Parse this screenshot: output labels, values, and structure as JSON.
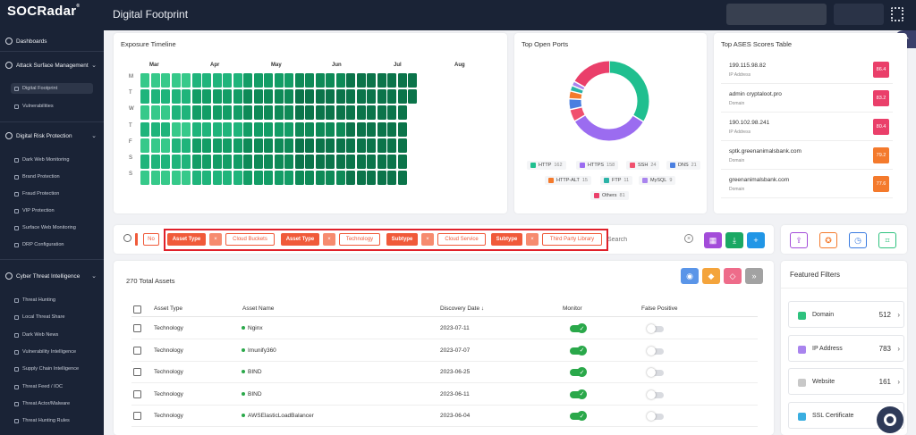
{
  "app": {
    "logo": "SOCRadar",
    "logo_mark": "®",
    "page_title": "Digital Footprint"
  },
  "sidebar": {
    "dashboards": "Dashboards",
    "attack_surface": "Attack Surface Management",
    "digital_footprint": "Digital Footprint",
    "vulnerabilities": "Vulnerabilities",
    "digital_risk": "Digital Risk Protection",
    "dark_web_monitoring": "Dark Web Monitoring",
    "brand_protection": "Brand Protection",
    "fraud_protection": "Fraud Protection",
    "vip_protection": "VIP Protection",
    "surface_web_monitoring": "Surface Web Monitoring",
    "drp_configuration": "DRP Configuration",
    "cti": "Cyber Threat Intelligence",
    "threat_hunting": "Threat Hunting",
    "local_threat_share": "Local Threat Share",
    "dark_web_news": "Dark Web News",
    "vulnerability_intelligence": "Vulnerability Intelligence",
    "supply_chain_intelligence": "Supply Chain Intelligence",
    "threat_feed": "Threat Feed / IOC",
    "threat_actor": "Threat Actor/Malware",
    "threat_hunting_rules": "Threat Hunting Rules"
  },
  "exposure": {
    "title": "Exposure Timeline",
    "months": [
      "Mar",
      "Apr",
      "May",
      "Jun",
      "Jul",
      "Aug"
    ],
    "days": [
      "M",
      "T",
      "W",
      "T",
      "F",
      "S",
      "S"
    ],
    "weeks": 27
  },
  "ports": {
    "title": "Top Open Ports",
    "items": [
      {
        "label": "HTTP",
        "count": "162",
        "color": "#1fbf8f"
      },
      {
        "label": "HTTPS",
        "count": "158",
        "color": "#9b6cf0"
      },
      {
        "label": "SSH",
        "count": "24",
        "color": "#f0506e"
      },
      {
        "label": "DNS",
        "count": "21",
        "color": "#4a7fe0"
      },
      {
        "label": "HTTP-ALT",
        "count": "15",
        "color": "#f47a2c"
      },
      {
        "label": "FTP",
        "count": "11",
        "color": "#2bb3a7"
      },
      {
        "label": "MySQL",
        "count": "9",
        "color": "#a984ee"
      },
      {
        "label": "Others",
        "count": "81",
        "color": "#ea3f6a"
      }
    ]
  },
  "ases": {
    "title": "Top ASES Scores Table",
    "rows": [
      {
        "name": "199.115.98.82",
        "type": "IP Address",
        "score": "86.4",
        "color": "#ea3f6a"
      },
      {
        "name": "admin cryptaloot.pro",
        "type": "Domain",
        "score": "83.2",
        "color": "#ea3f6a"
      },
      {
        "name": "190.102.98.241",
        "type": "IP Address",
        "score": "80.4",
        "color": "#ea3f6a"
      },
      {
        "name": "sptk.greenanimalsbank.com",
        "type": "Domain",
        "score": "79.2",
        "color": "#f47a2c"
      },
      {
        "name": "greenanimalsbank.com",
        "type": "Domain",
        "score": "77.6",
        "color": "#f47a2c"
      }
    ]
  },
  "filters": {
    "no_label": "No",
    "chips": [
      {
        "key": "Asset Type",
        "value": "Cloud Buckets"
      },
      {
        "key": "Asset Type",
        "value": "Technology"
      },
      {
        "key": "Subtype",
        "value": "Cloud Service"
      },
      {
        "key": "Subtype",
        "value": "Third Party Library"
      }
    ],
    "remove_label": "×",
    "search_placeholder": "Search"
  },
  "assets": {
    "total": "270 Total Assets",
    "columns": [
      "Asset Type",
      "Asset Name",
      "Discovery Date ↓",
      "Monitor",
      "False Positive"
    ],
    "rows": [
      {
        "type": "Technology",
        "name": "Nginx",
        "date": "2023-07-11"
      },
      {
        "type": "Technology",
        "name": "Imunify360",
        "date": "2023-07-07"
      },
      {
        "type": "Technology",
        "name": "BIND",
        "date": "2023-06-25"
      },
      {
        "type": "Technology",
        "name": "BIND",
        "date": "2023-06-11"
      },
      {
        "type": "Technology",
        "name": "AWSElasticLoadBalancer",
        "date": "2023-06-04"
      }
    ]
  },
  "featured": {
    "title": "Featured Filters",
    "items": [
      {
        "label": "Domain",
        "count": "512",
        "color": "#2ec27e"
      },
      {
        "label": "IP Address",
        "count": "783",
        "color": "#a984ee"
      },
      {
        "label": "Website",
        "count": "161",
        "color": "#c8c8c8"
      },
      {
        "label": "SSL Certificate",
        "count": "",
        "color": "#3aaee0"
      }
    ]
  },
  "colors": {
    "accent": "#f05a3a",
    "highlight": "#e0202a",
    "dark": "#1a2336"
  }
}
